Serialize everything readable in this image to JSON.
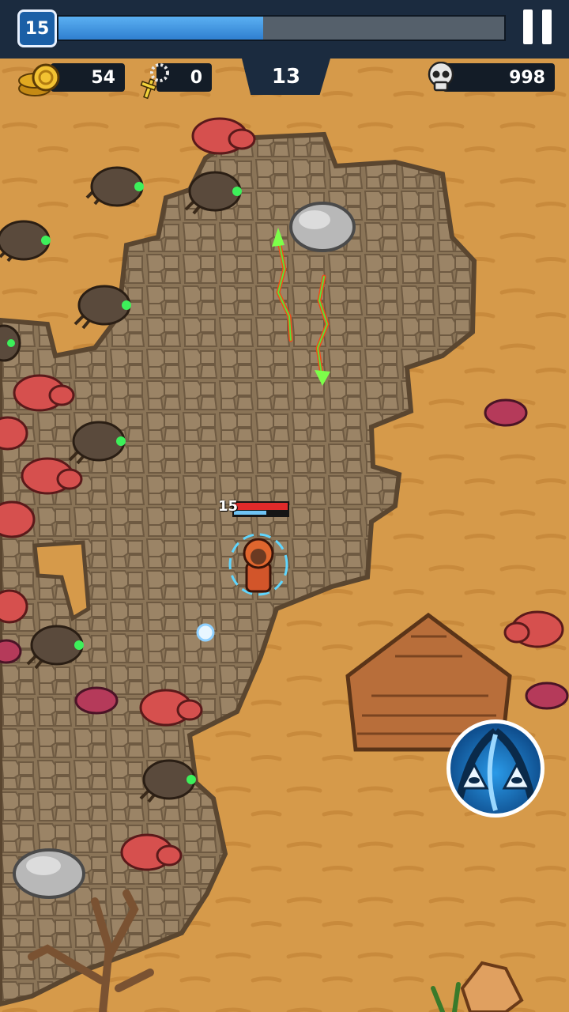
{
  "hud": {
    "level": "15",
    "xp_progress": 0.46,
    "coins": "54",
    "rosaries": "0",
    "wave": "13",
    "kills": "998"
  },
  "player": {
    "level_tag": "15",
    "hp_fraction": 1.0,
    "mana_fraction": 0.6
  },
  "icons": {
    "pause": "pause-icon",
    "coin": "gold-coin-stack-icon",
    "rosary": "rosary-cross-icon",
    "skull": "skull-icon",
    "ability": "eye-of-providence-ability-icon"
  },
  "colors": {
    "xp_fill": "#3c8fe0",
    "hp": "#e02a2a",
    "mana": "#6fc4f5",
    "hud_bg": "#1b2b3f",
    "sand": "#d69a4a"
  }
}
